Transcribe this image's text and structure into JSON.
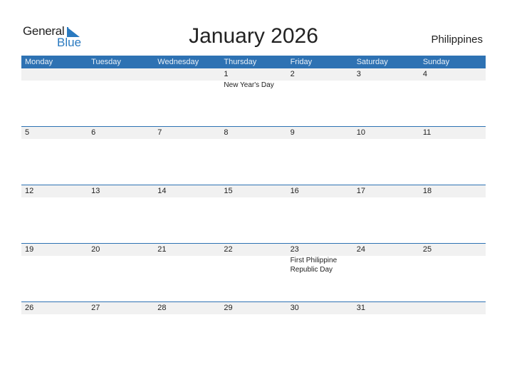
{
  "logo": {
    "general": "General",
    "blue": "Blue"
  },
  "title": "January 2026",
  "country": "Philippines",
  "colors": {
    "accent": "#2e72b3",
    "band": "#f1f1f1"
  },
  "weekdays": [
    "Monday",
    "Tuesday",
    "Wednesday",
    "Thursday",
    "Friday",
    "Saturday",
    "Sunday"
  ],
  "weeks": [
    [
      {
        "day": "",
        "event": ""
      },
      {
        "day": "",
        "event": ""
      },
      {
        "day": "",
        "event": ""
      },
      {
        "day": "1",
        "event": "New Year's Day"
      },
      {
        "day": "2",
        "event": ""
      },
      {
        "day": "3",
        "event": ""
      },
      {
        "day": "4",
        "event": ""
      }
    ],
    [
      {
        "day": "5",
        "event": ""
      },
      {
        "day": "6",
        "event": ""
      },
      {
        "day": "7",
        "event": ""
      },
      {
        "day": "8",
        "event": ""
      },
      {
        "day": "9",
        "event": ""
      },
      {
        "day": "10",
        "event": ""
      },
      {
        "day": "11",
        "event": ""
      }
    ],
    [
      {
        "day": "12",
        "event": ""
      },
      {
        "day": "13",
        "event": ""
      },
      {
        "day": "14",
        "event": ""
      },
      {
        "day": "15",
        "event": ""
      },
      {
        "day": "16",
        "event": ""
      },
      {
        "day": "17",
        "event": ""
      },
      {
        "day": "18",
        "event": ""
      }
    ],
    [
      {
        "day": "19",
        "event": ""
      },
      {
        "day": "20",
        "event": ""
      },
      {
        "day": "21",
        "event": ""
      },
      {
        "day": "22",
        "event": ""
      },
      {
        "day": "23",
        "event": "First Philippine Republic Day"
      },
      {
        "day": "24",
        "event": ""
      },
      {
        "day": "25",
        "event": ""
      }
    ],
    [
      {
        "day": "26",
        "event": ""
      },
      {
        "day": "27",
        "event": ""
      },
      {
        "day": "28",
        "event": ""
      },
      {
        "day": "29",
        "event": ""
      },
      {
        "day": "30",
        "event": ""
      },
      {
        "day": "31",
        "event": ""
      },
      {
        "day": "",
        "event": ""
      }
    ]
  ]
}
